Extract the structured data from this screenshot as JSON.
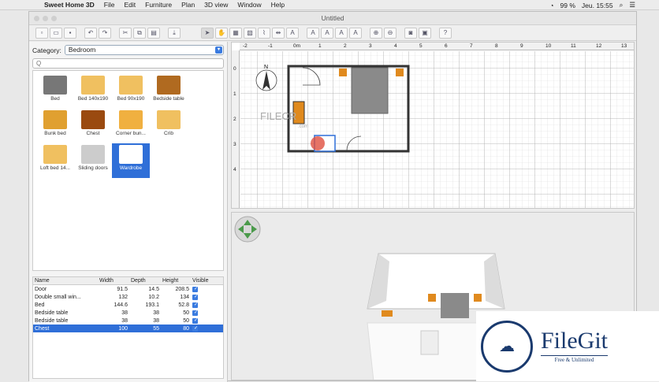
{
  "menubar": {
    "app_name": "Sweet Home 3D",
    "menus": [
      "File",
      "Edit",
      "Furniture",
      "Plan",
      "3D view",
      "Window",
      "Help"
    ],
    "battery": "99 %",
    "clock": "Jeu. 15:55"
  },
  "window": {
    "title": "Untitled"
  },
  "category": {
    "label": "Category:",
    "value": "Bedroom"
  },
  "search": {
    "placeholder": "Q"
  },
  "catalog": [
    {
      "label": "Bed"
    },
    {
      "label": "Bed 140x190"
    },
    {
      "label": "Bed 90x190"
    },
    {
      "label": "Bedside table"
    },
    {
      "label": "Bunk bed"
    },
    {
      "label": "Chest"
    },
    {
      "label": "Corner bun..."
    },
    {
      "label": "Crib"
    },
    {
      "label": "Loft bed 14..."
    },
    {
      "label": "Sliding doors"
    },
    {
      "label": "Wardrobe",
      "selected": true
    }
  ],
  "furniture_table": {
    "headers": [
      "Name",
      "Width",
      "Depth",
      "Height",
      "Visible"
    ],
    "rows": [
      {
        "name": "Door",
        "width": "91.5",
        "depth": "14.5",
        "height": "208.5",
        "visible": true
      },
      {
        "name": "Double small win...",
        "width": "132",
        "depth": "10.2",
        "height": "134",
        "visible": true
      },
      {
        "name": "Bed",
        "width": "144.6",
        "depth": "193.1",
        "height": "52.8",
        "visible": true
      },
      {
        "name": "Bedside table",
        "width": "38",
        "depth": "38",
        "height": "50",
        "visible": true
      },
      {
        "name": "Bedside table",
        "width": "38",
        "depth": "38",
        "height": "50",
        "visible": true
      },
      {
        "name": "Chest",
        "width": "100",
        "depth": "55",
        "height": "80",
        "visible": true,
        "selected": true
      }
    ]
  },
  "plan": {
    "ruler_h": [
      "-2",
      "-1",
      "0m",
      "1",
      "2",
      "3",
      "4",
      "5",
      "6",
      "7",
      "8",
      "9",
      "10",
      "11",
      "12",
      "13"
    ],
    "ruler_v": [
      "0",
      "1",
      "2",
      "3",
      "4"
    ],
    "compass_label": "N",
    "watermark": "FILECR",
    "watermark_sub": ".com"
  },
  "branding": {
    "name": "FileGit",
    "tagline": "Free & Unlimited"
  },
  "colors": {
    "accent": "#2f6fd8",
    "furniture": "#e08a1e",
    "bed": "#8a8a8a"
  }
}
